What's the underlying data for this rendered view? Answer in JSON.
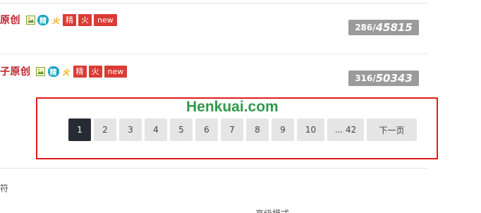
{
  "threads": [
    {
      "title": "原创",
      "icons": {
        "image": "image-icon",
        "jing": "精",
        "huo": "火",
        "tag1": "精",
        "tag2": "火",
        "tag_new": "new"
      },
      "stats": {
        "replies": "286/",
        "views": "45815"
      }
    },
    {
      "title": "子原创",
      "icons": {
        "image": "image-icon",
        "jing": "精",
        "huo": "火",
        "tag1": "精",
        "tag2": "火",
        "tag_new": "new"
      },
      "stats": {
        "replies": "316/",
        "views": "50343"
      }
    }
  ],
  "watermark": "Henkuai.com",
  "pagination": {
    "pages": [
      "1",
      "2",
      "3",
      "4",
      "5",
      "6",
      "7",
      "8",
      "9",
      "10",
      "... 42"
    ],
    "current": "1",
    "next_label": "下一页"
  },
  "footer": {
    "left_text": "符",
    "bottom_text": "高级模式"
  },
  "colors": {
    "title": "#c0232b",
    "tag": "#db3b35",
    "stats": "#9b9b9b",
    "pager_active": "#262b34",
    "highlight_box": "#e11b1b",
    "watermark": "#2f9a4a"
  }
}
